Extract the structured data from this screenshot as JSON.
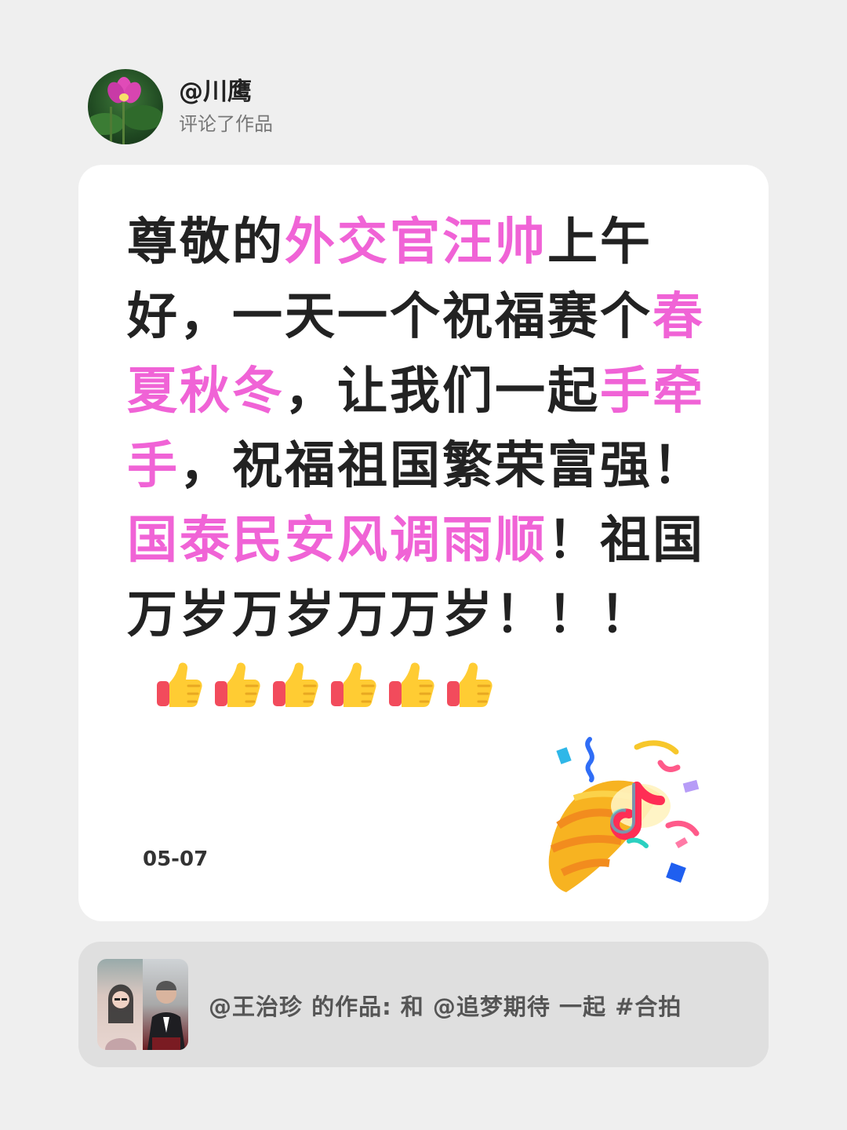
{
  "user": {
    "name": "@川鹰",
    "action": "评论了作品"
  },
  "comment": {
    "segments": [
      {
        "text": "尊敬的",
        "highlight": false
      },
      {
        "text": "外交官汪帅",
        "highlight": true
      },
      {
        "text": "上午好，一天一个祝福赛个",
        "highlight": false
      },
      {
        "text": "春夏秋冬",
        "highlight": true
      },
      {
        "text": "，让我们一起",
        "highlight": false
      },
      {
        "text": "手牵手",
        "highlight": true
      },
      {
        "text": "，祝福祖国繁荣富强！",
        "highlight": false
      },
      {
        "text": "国泰民安风调雨顺",
        "highlight": true
      },
      {
        "text": "！祖国万岁万岁万万岁！！！",
        "highlight": false
      }
    ],
    "emoji_count": 6,
    "emoji_name": "thumbs-up-icon",
    "date": "05-07"
  },
  "work": {
    "text": "@王治珍 的作品: 和 @追梦期待 一起 #合拍"
  },
  "colors": {
    "highlight": "#f063d6",
    "background": "#efefef",
    "card": "#ffffff",
    "work_card": "#dfdfdf"
  }
}
